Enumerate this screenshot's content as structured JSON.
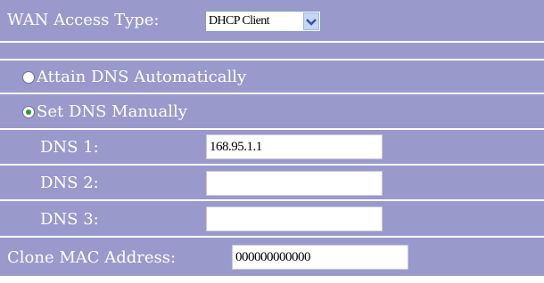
{
  "wan": {
    "label": "WAN Access Type:",
    "selected": "DHCP Client"
  },
  "dns": {
    "auto_label": "Attain DNS Automatically",
    "manual_label": "Set DNS Manually",
    "auto_selected": false,
    "manual_selected": true,
    "dns1_label": "DNS 1:",
    "dns1_value": "168.95.1.1",
    "dns2_label": "DNS 2:",
    "dns2_value": "",
    "dns3_label": "DNS 3:",
    "dns3_value": ""
  },
  "clone_mac": {
    "label": "Clone MAC Address:",
    "value": "000000000000"
  },
  "colors": {
    "panel": "#9999cc",
    "radio_dot": "#2d9a2d",
    "arrow": "#3355aa"
  }
}
